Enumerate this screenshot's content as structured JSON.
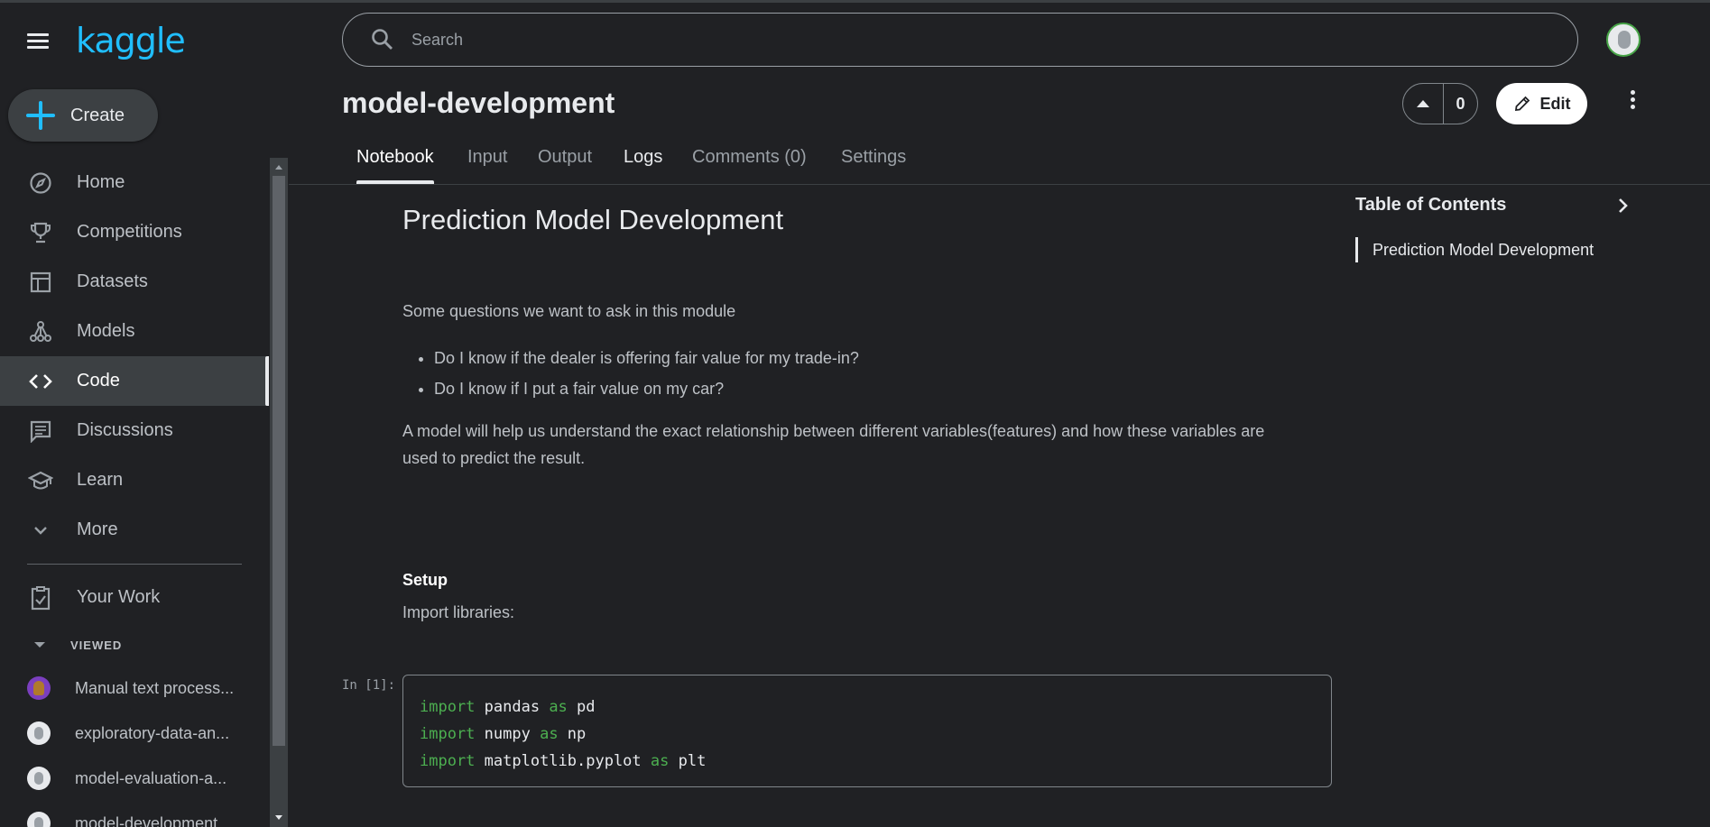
{
  "app": {
    "logo": "kaggle",
    "create_label": "Create"
  },
  "nav": {
    "items": [
      {
        "label": "Home"
      },
      {
        "label": "Competitions"
      },
      {
        "label": "Datasets"
      },
      {
        "label": "Models"
      },
      {
        "label": "Code",
        "active": true
      },
      {
        "label": "Discussions"
      },
      {
        "label": "Learn"
      },
      {
        "label": "More"
      }
    ],
    "your_work": "Your Work",
    "viewed_label": "VIEWED",
    "recent": [
      {
        "label": "Manual text process..."
      },
      {
        "label": "exploratory-data-an..."
      },
      {
        "label": "model-evaluation-a..."
      },
      {
        "label": "model-development..."
      }
    ]
  },
  "search": {
    "placeholder": "Search"
  },
  "header": {
    "title": "model-development",
    "vote_count": "0",
    "edit_label": "Edit"
  },
  "tabs": [
    {
      "label": "Notebook",
      "active": true
    },
    {
      "label": "Input"
    },
    {
      "label": "Output"
    },
    {
      "label": "Logs"
    },
    {
      "label": "Comments (0)"
    },
    {
      "label": "Settings"
    }
  ],
  "notebook": {
    "title": "Prediction Model Development",
    "intro": "Some questions we want to ask in this module",
    "bullets": [
      "Do I know if the dealer is offering fair value for my trade-in?",
      "Do I know if I put a fair value on my car?"
    ],
    "paragraph_line1": "A model will help us understand the exact relationship between different variables(features) and how these variables are",
    "paragraph_line2": "used to predict the result.",
    "setup_heading": "Setup",
    "setup_text": "Import libraries:",
    "cell_prompt": "In [1]:",
    "code": [
      {
        "kw1": "import",
        "mod": " pandas ",
        "kw2": "as",
        "alias": " pd"
      },
      {
        "kw1": "import",
        "mod": " numpy ",
        "kw2": "as",
        "alias": " np"
      },
      {
        "kw1": "import",
        "mod": " matplotlib.pyplot ",
        "kw2": "as",
        "alias": " plt"
      }
    ]
  },
  "toc": {
    "title": "Table of Contents",
    "items": [
      "Prediction Model Development"
    ]
  },
  "colors": {
    "accent": "#20beff",
    "background": "#202124",
    "keyword": "#4caf50"
  }
}
